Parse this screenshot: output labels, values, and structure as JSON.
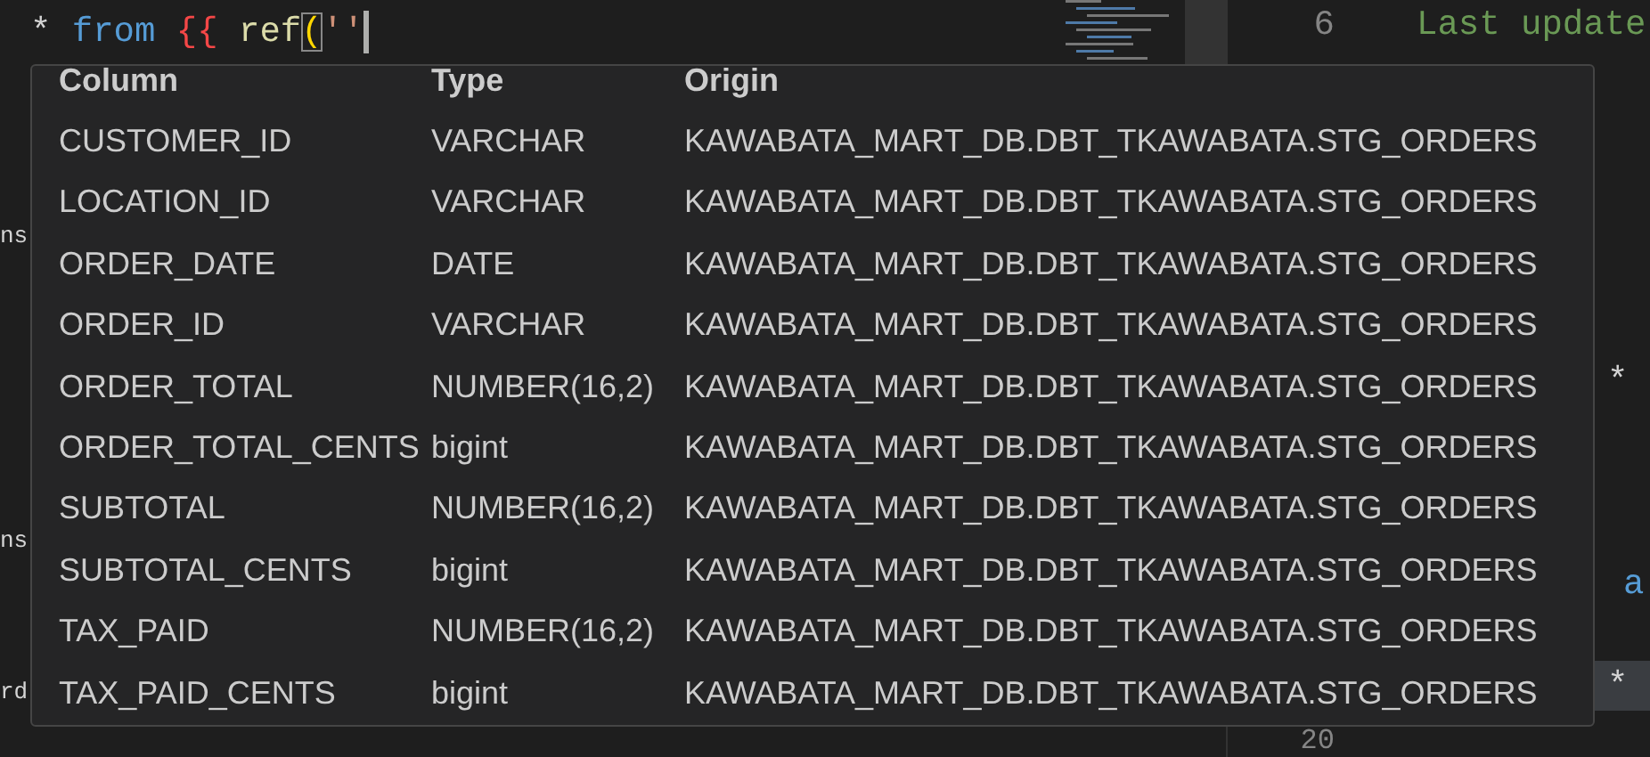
{
  "editor": {
    "current_line": {
      "tokens": [
        {
          "text": "* ",
          "kind": "operator"
        },
        {
          "text": "from ",
          "kind": "keyword"
        },
        {
          "text": "{{ ",
          "kind": "jinja"
        },
        {
          "text": "ref",
          "kind": "function"
        },
        {
          "text": "(",
          "kind": "bracket"
        },
        {
          "text": "''",
          "kind": "string"
        }
      ]
    },
    "left_fragments": [
      {
        "text": "ns"
      },
      {
        "text": "ns"
      },
      {
        "text": "rd"
      }
    ],
    "right_lines": [
      {
        "number": "6",
        "tokens": [
          {
            "text": "Last update",
            "kind": "comment"
          }
        ],
        "highlighted": false
      },
      {
        "tokens": [
          {
            "text": "*",
            "kind": "operator"
          }
        ],
        "highlighted": false
      },
      {
        "tokens": [
          {
            "text": "a",
            "kind": "keyword"
          }
        ],
        "highlighted": false
      },
      {
        "tokens": [
          {
            "text": "*",
            "kind": "operator"
          }
        ],
        "highlighted": true
      },
      {
        "number": "20"
      }
    ]
  },
  "column_popup": {
    "headers": [
      "Column",
      "Type",
      "Origin"
    ],
    "rows": [
      [
        "CUSTOMER_ID",
        "VARCHAR",
        "KAWABATA_MART_DB.DBT_TKAWABATA.STG_ORDERS"
      ],
      [
        "LOCATION_ID",
        "VARCHAR",
        "KAWABATA_MART_DB.DBT_TKAWABATA.STG_ORDERS"
      ],
      [
        "ORDER_DATE",
        "DATE",
        "KAWABATA_MART_DB.DBT_TKAWABATA.STG_ORDERS"
      ],
      [
        "ORDER_ID",
        "VARCHAR",
        "KAWABATA_MART_DB.DBT_TKAWABATA.STG_ORDERS"
      ],
      [
        "ORDER_TOTAL",
        "NUMBER(16,2)",
        "KAWABATA_MART_DB.DBT_TKAWABATA.STG_ORDERS"
      ],
      [
        "ORDER_TOTAL_CENTS",
        "bigint",
        "KAWABATA_MART_DB.DBT_TKAWABATA.STG_ORDERS"
      ],
      [
        "SUBTOTAL",
        "NUMBER(16,2)",
        "KAWABATA_MART_DB.DBT_TKAWABATA.STG_ORDERS"
      ],
      [
        "SUBTOTAL_CENTS",
        "bigint",
        "KAWABATA_MART_DB.DBT_TKAWABATA.STG_ORDERS"
      ],
      [
        "TAX_PAID",
        "NUMBER(16,2)",
        "KAWABATA_MART_DB.DBT_TKAWABATA.STG_ORDERS"
      ],
      [
        "TAX_PAID_CENTS",
        "bigint",
        "KAWABATA_MART_DB.DBT_TKAWABATA.STG_ORDERS"
      ]
    ]
  }
}
